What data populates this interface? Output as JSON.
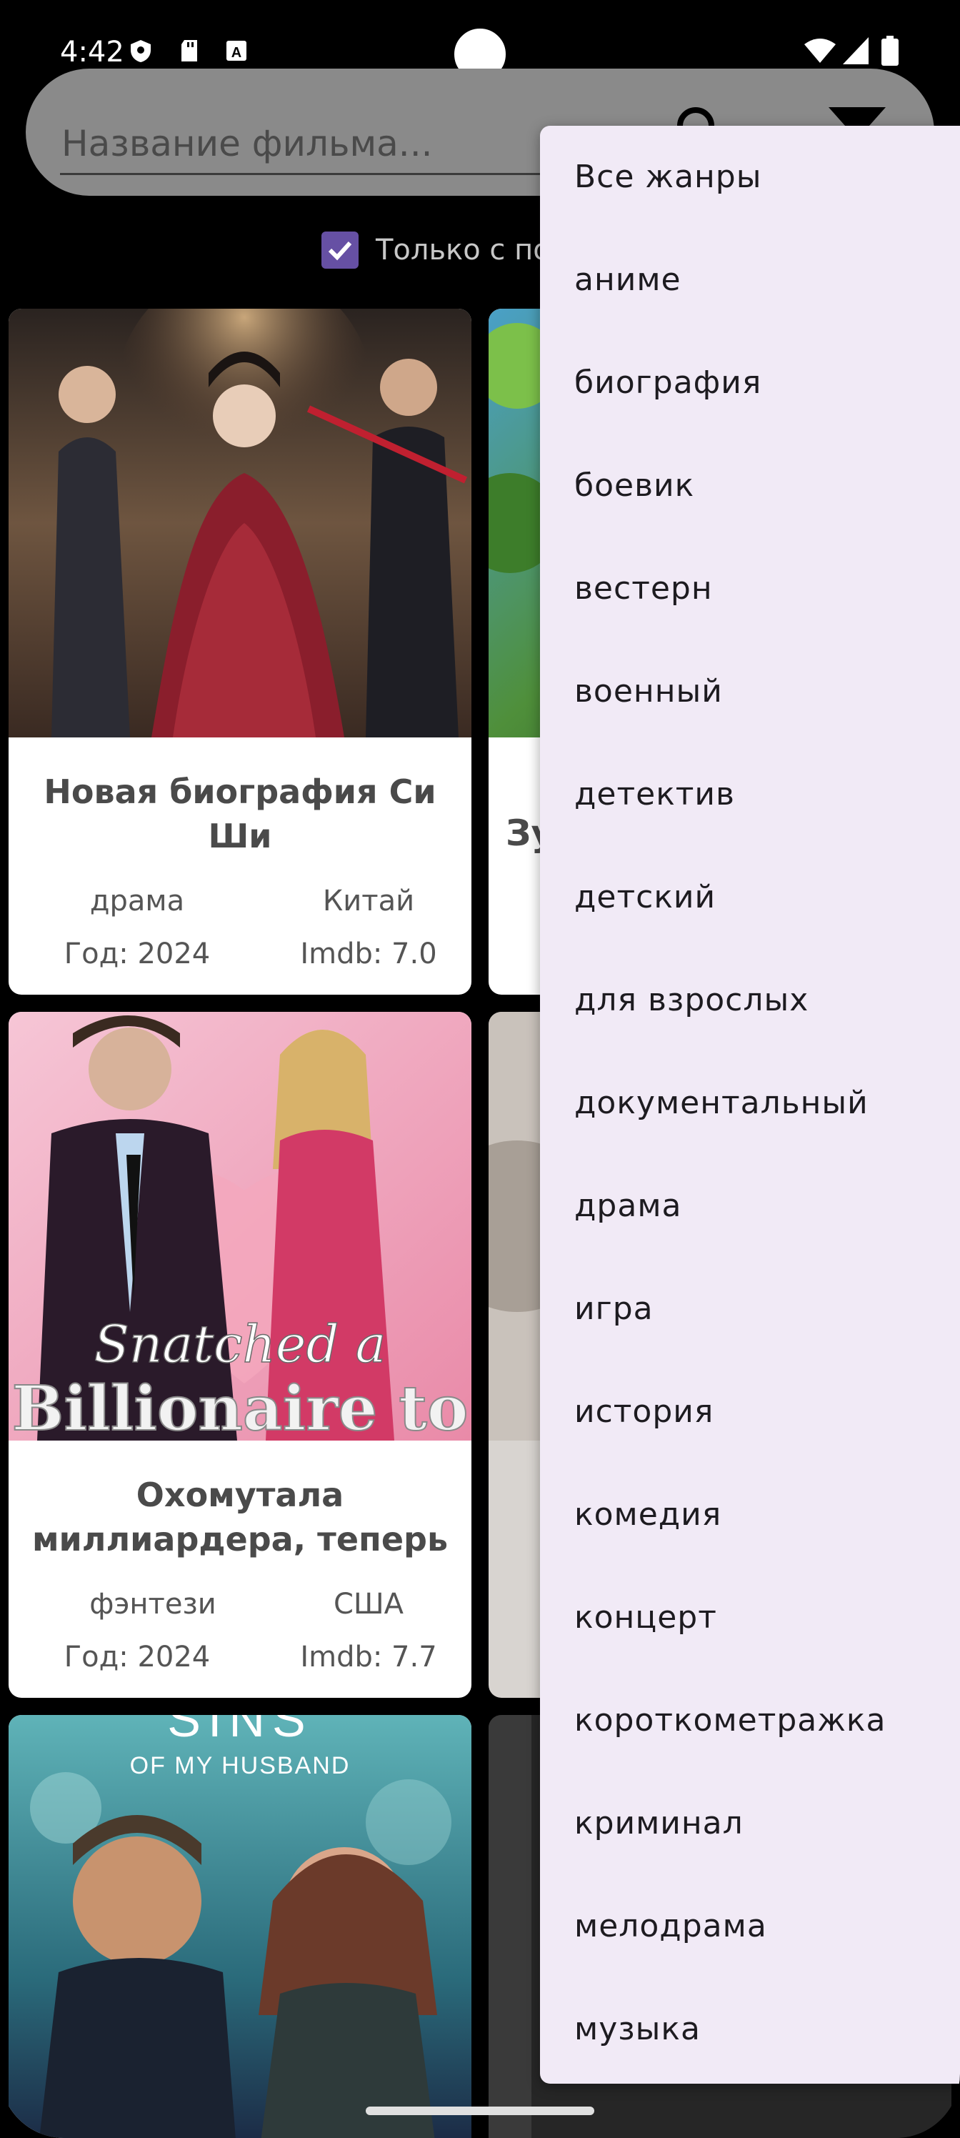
{
  "status_bar": {
    "time": "4:42"
  },
  "search": {
    "placeholder": "Название фильма..."
  },
  "filter": {
    "checkbox_label": "Только с по",
    "checked": true
  },
  "movies": [
    {
      "title": "Новая биография Си Ши",
      "genre": "драма",
      "country": "Китай",
      "year": "Год: 2024",
      "imdb": "Imdb: 7.0"
    },
    {
      "title": "Зу",
      "genre": "",
      "country": "",
      "year": "",
      "imdb": ""
    },
    {
      "title": "Охомутала миллиардера, теперь",
      "genre": "фэнтези",
      "country": "США",
      "year": "Год: 2024",
      "imdb": "Imdb: 7.7",
      "poster_text": "Snatched a Billionaire to"
    },
    {
      "title": "",
      "poster_text": "SINS OF MY HUSBAND"
    }
  ],
  "genre_menu": {
    "items": [
      "Все жанры",
      "аниме",
      "биография",
      "боевик",
      "вестерн",
      "военный",
      "детектив",
      "детский",
      "для взрослых",
      "документальный",
      "драма",
      "игра",
      "история",
      "комедия",
      "концерт",
      "короткометражка",
      "криминал",
      "мелодрама",
      "музыка"
    ]
  },
  "colors": {
    "accent": "#6650a4",
    "menu_bg": "#f1eaf6",
    "search_bg": "#8a8a8a"
  }
}
